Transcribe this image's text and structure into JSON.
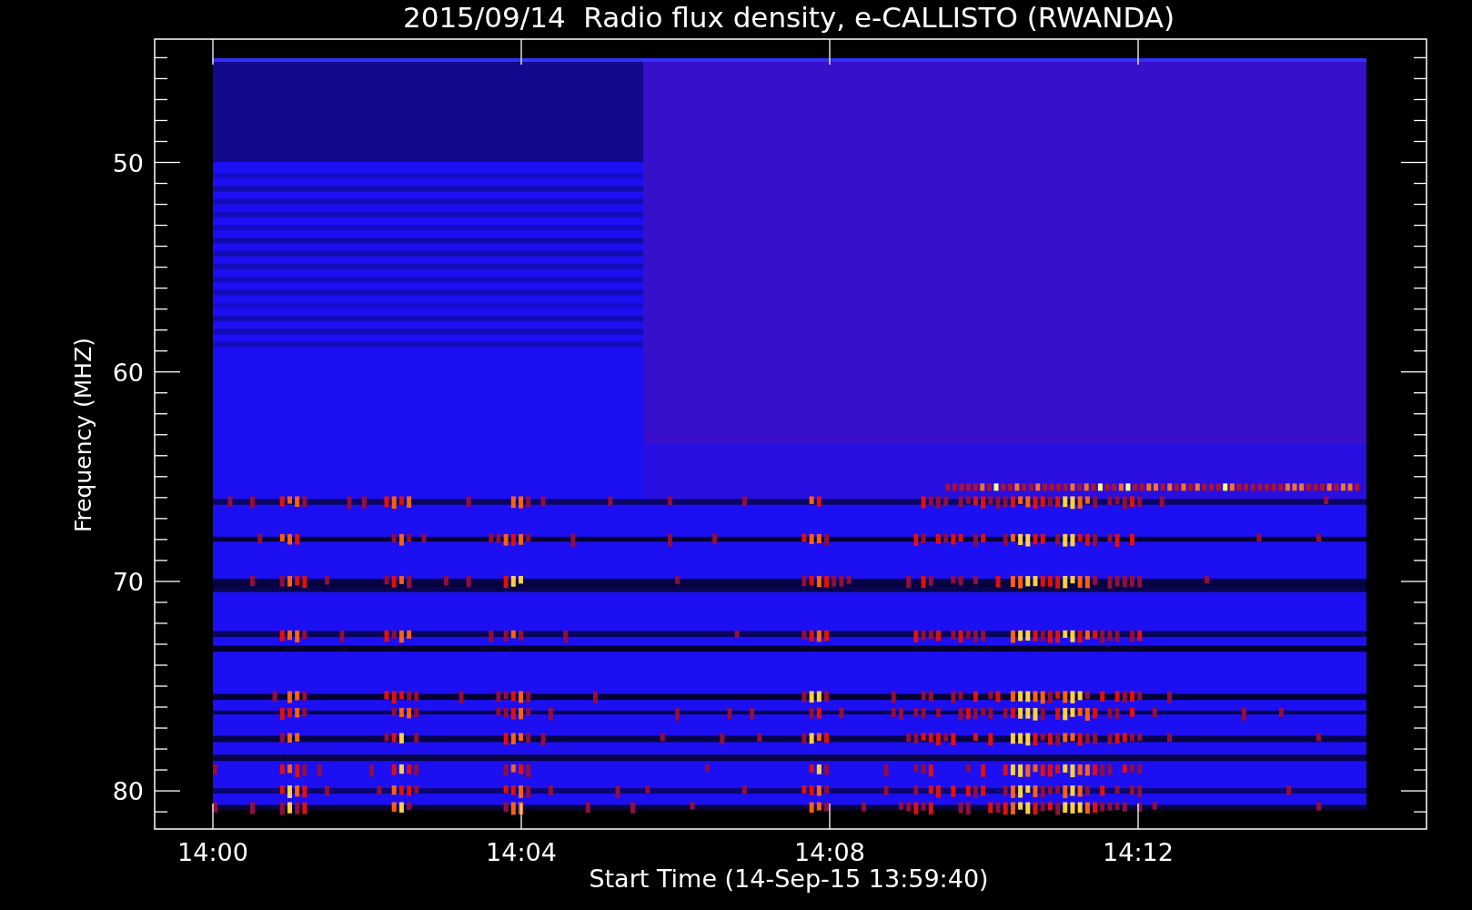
{
  "title": "2015/09/14  Radio flux density, e-CALLISTO (RWANDA)",
  "y_axis": {
    "label": "Frequency (MHZ)",
    "ticks": [
      "50",
      "60",
      "70",
      "80"
    ]
  },
  "x_axis": {
    "label": "Start Time (14-Sep-15 13:59:40)",
    "ticks": [
      "14:00",
      "14:04",
      "14:08",
      "14:12"
    ]
  }
}
